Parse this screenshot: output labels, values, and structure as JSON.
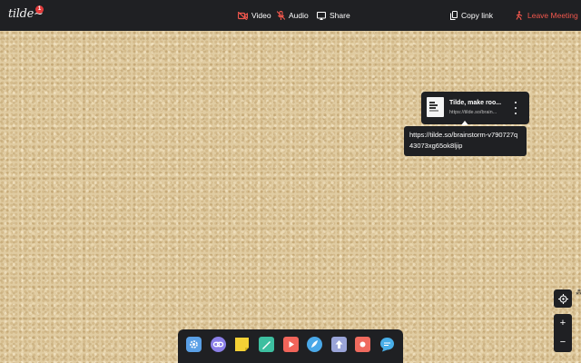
{
  "app": {
    "logo": "tilde~",
    "notification_count": "1"
  },
  "topbar": {
    "video_label": "Video",
    "audio_label": "Audio",
    "share_label": "Share",
    "copy_link_label": "Copy link",
    "leave_label": "Leave Meeting"
  },
  "link_card": {
    "title": "Tilde, make roo...",
    "url": "https://tilde.so/brain..."
  },
  "tooltip": {
    "text": "https://tilde.so/brainstorm-v790727q43073xg65ok8ljip"
  },
  "zoom": {
    "in_label": "+",
    "out_label": "−"
  },
  "dock": {
    "tools": [
      {
        "name": "settings-tool",
        "color": "#5aa0e6"
      },
      {
        "name": "link-tool",
        "color": "#8b7fe8"
      },
      {
        "name": "sticky-note-tool",
        "color": "#f5d135"
      },
      {
        "name": "pen-tool",
        "color": "#3dbfa0"
      },
      {
        "name": "video-tool",
        "color": "#f0645a"
      },
      {
        "name": "draw-tool",
        "color": "#4aa8e8"
      },
      {
        "name": "upload-tool",
        "color": "#9aa4d8"
      },
      {
        "name": "record-tool",
        "color": "#ef6a5e"
      },
      {
        "name": "chat-tool",
        "color": "#48aee8"
      }
    ]
  },
  "colors": {
    "accent_red": "#f2574d",
    "bar_bg": "#1f2023"
  }
}
